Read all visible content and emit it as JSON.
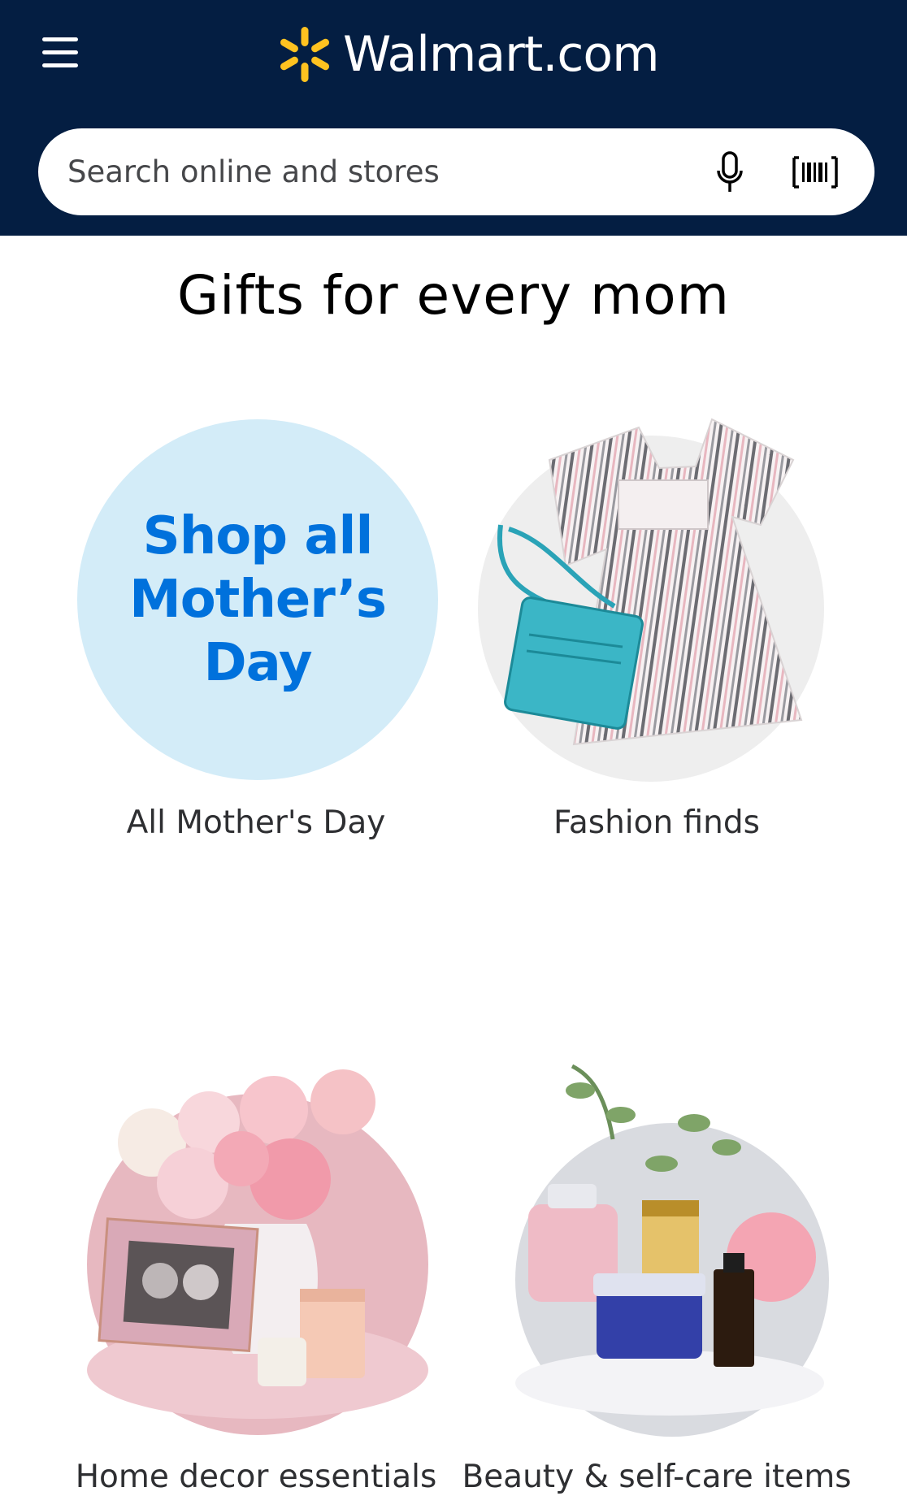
{
  "header": {
    "logo_text": "Walmart.com",
    "menu_icon": "hamburger-menu-icon",
    "logo_icon": "walmart-spark-icon",
    "brand_yellow": "#ffc220",
    "background": "#041e42"
  },
  "search": {
    "placeholder": "Search online and stores",
    "mic_icon": "microphone-icon",
    "scan_icon": "barcode-scan-icon"
  },
  "section": {
    "title": "Gifts for every mom",
    "tiles": [
      {
        "label": "All Mother's Day",
        "badge_lines": [
          "Shop all",
          "Mother’s",
          "Day"
        ],
        "badge_color": "#0071dc",
        "circle_color": "#d3ecf8"
      },
      {
        "label": "Fashion finds"
      },
      {
        "label": "Home decor essentials"
      },
      {
        "label": "Beauty & self-care items"
      }
    ]
  }
}
